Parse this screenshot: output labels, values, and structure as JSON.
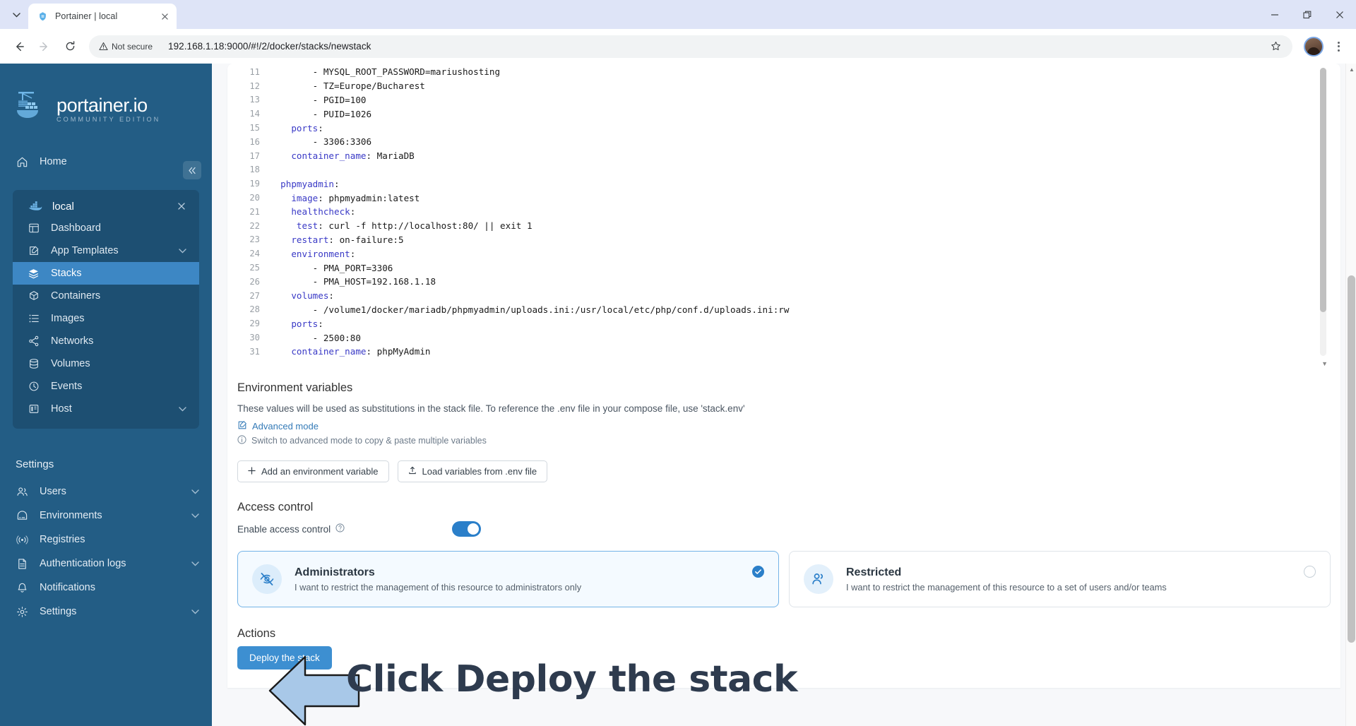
{
  "browser": {
    "tab": {
      "title": "Portainer | local",
      "favicon_icon": "portainer-favicon",
      "close_icon": "close-icon"
    },
    "tabstrip_chevron_icon": "chevron-down-icon",
    "window_controls": {
      "minimize_icon": "minimize-icon",
      "maximize_icon": "restore-icon",
      "close_icon": "window-close-icon"
    },
    "nav": {
      "back_icon": "arrow-left-icon",
      "forward_icon": "arrow-right-icon",
      "reload_icon": "reload-icon"
    },
    "omnibox": {
      "security_label": "Not secure",
      "security_icon": "warning-triangle-icon",
      "url": "192.168.1.18:9000/#!/2/docker/stacks/newstack",
      "bookmark_icon": "star-icon"
    },
    "profile_icon": "avatar",
    "menu_icon": "kebab-menu-icon"
  },
  "sidebar": {
    "logo": {
      "title": "portainer.io",
      "subtitle": "COMMUNITY EDITION",
      "icon": "portainer-logo-icon"
    },
    "collapse_icon": "chevron-double-left-icon",
    "home": {
      "label": "Home",
      "icon": "home-icon"
    },
    "environment": {
      "name": "local",
      "icon": "docker-icon",
      "close_icon": "close-icon",
      "items": [
        {
          "label": "Dashboard",
          "icon": "dashboard-icon",
          "active": false,
          "chevron": ""
        },
        {
          "label": "App Templates",
          "icon": "template-icon",
          "active": false,
          "chevron": "⌄"
        },
        {
          "label": "Stacks",
          "icon": "stacks-icon",
          "active": true,
          "chevron": ""
        },
        {
          "label": "Containers",
          "icon": "container-icon",
          "active": false,
          "chevron": ""
        },
        {
          "label": "Images",
          "icon": "images-icon",
          "active": false,
          "chevron": ""
        },
        {
          "label": "Networks",
          "icon": "networks-icon",
          "active": false,
          "chevron": ""
        },
        {
          "label": "Volumes",
          "icon": "volumes-icon",
          "active": false,
          "chevron": ""
        },
        {
          "label": "Events",
          "icon": "events-icon",
          "active": false,
          "chevron": ""
        },
        {
          "label": "Host",
          "icon": "host-icon",
          "active": false,
          "chevron": "⌄"
        }
      ]
    },
    "settings_label": "Settings",
    "settings_items": [
      {
        "label": "Users",
        "icon": "users-icon",
        "chevron": "⌄"
      },
      {
        "label": "Environments",
        "icon": "environments-icon",
        "chevron": "⌄"
      },
      {
        "label": "Registries",
        "icon": "registries-icon",
        "chevron": ""
      },
      {
        "label": "Authentication logs",
        "icon": "auth-logs-icon",
        "chevron": "⌄"
      },
      {
        "label": "Notifications",
        "icon": "notifications-icon",
        "chevron": ""
      },
      {
        "label": "Settings",
        "icon": "gear-icon",
        "chevron": "⌄"
      }
    ]
  },
  "editor": {
    "lines": [
      {
        "n": "11",
        "text": "        - MYSQL_ROOT_PASSWORD=mariushosting",
        "key": ""
      },
      {
        "n": "12",
        "text": "        - TZ=Europe/Bucharest",
        "key": ""
      },
      {
        "n": "13",
        "text": "        - PGID=100",
        "key": ""
      },
      {
        "n": "14",
        "text": "        - PUID=1026",
        "key": ""
      },
      {
        "n": "15",
        "text": "    ports:",
        "key": "ports"
      },
      {
        "n": "16",
        "text": "        - 3306:3306",
        "key": ""
      },
      {
        "n": "17",
        "text": "    container_name: MariaDB",
        "key": "container_name"
      },
      {
        "n": "18",
        "text": "",
        "key": ""
      },
      {
        "n": "19",
        "text": "  phpmyadmin:",
        "key": "phpmyadmin"
      },
      {
        "n": "20",
        "text": "    image: phpmyadmin:latest",
        "key": "image"
      },
      {
        "n": "21",
        "text": "    healthcheck:",
        "key": "healthcheck"
      },
      {
        "n": "22",
        "text": "     test: curl -f http://localhost:80/ || exit 1",
        "key": "test"
      },
      {
        "n": "23",
        "text": "    restart: on-failure:5",
        "key": "restart"
      },
      {
        "n": "24",
        "text": "    environment:",
        "key": "environment"
      },
      {
        "n": "25",
        "text": "        - PMA_PORT=3306",
        "key": ""
      },
      {
        "n": "26",
        "text": "        - PMA_HOST=192.168.1.18",
        "key": ""
      },
      {
        "n": "27",
        "text": "    volumes:",
        "key": "volumes"
      },
      {
        "n": "28",
        "text": "        - /volume1/docker/mariadb/phpmyadmin/uploads.ini:/usr/local/etc/php/conf.d/uploads.ini:rw",
        "key": ""
      },
      {
        "n": "29",
        "text": "    ports:",
        "key": "ports"
      },
      {
        "n": "30",
        "text": "        - 2500:80",
        "key": ""
      },
      {
        "n": "31",
        "text": "    container_name: phpMyAdmin",
        "key": "container_name"
      }
    ]
  },
  "env_vars": {
    "title": "Environment variables",
    "description": "These values will be used as substitutions in the stack file. To reference the .env file in your compose file, use 'stack.env'",
    "advanced_mode_label": "Advanced mode",
    "advanced_mode_icon": "edit-square-icon",
    "hint": "Switch to advanced mode to copy & paste multiple variables",
    "hint_icon": "info-circle-icon",
    "add_button": {
      "label": "Add an environment variable",
      "icon": "plus-icon"
    },
    "load_button": {
      "label": "Load variables from .env file",
      "icon": "upload-icon"
    }
  },
  "access_control": {
    "title": "Access control",
    "enable_label": "Enable access control",
    "help_icon": "question-circle-icon",
    "toggle_on": true,
    "options": [
      {
        "id": "administrators",
        "title": "Administrators",
        "description": "I want to restrict the management of this resource to administrators only",
        "icon": "eye-off-icon",
        "selected": true
      },
      {
        "id": "restricted",
        "title": "Restricted",
        "description": "I want to restrict the management of this resource to a set of users and/or teams",
        "icon": "users-group-icon",
        "selected": false
      }
    ]
  },
  "actions": {
    "title": "Actions",
    "deploy_label": "Deploy the stack"
  },
  "annotation": {
    "text": "Click Deploy the stack",
    "arrow_icon": "left-arrow-callout",
    "arrow_fill": "#a8c8e8",
    "text_color": "#2e3b4e"
  },
  "colors": {
    "sidebar_bg": "#235d85",
    "accent_blue": "#3d8fd1",
    "active_item": "#3d87c4"
  }
}
